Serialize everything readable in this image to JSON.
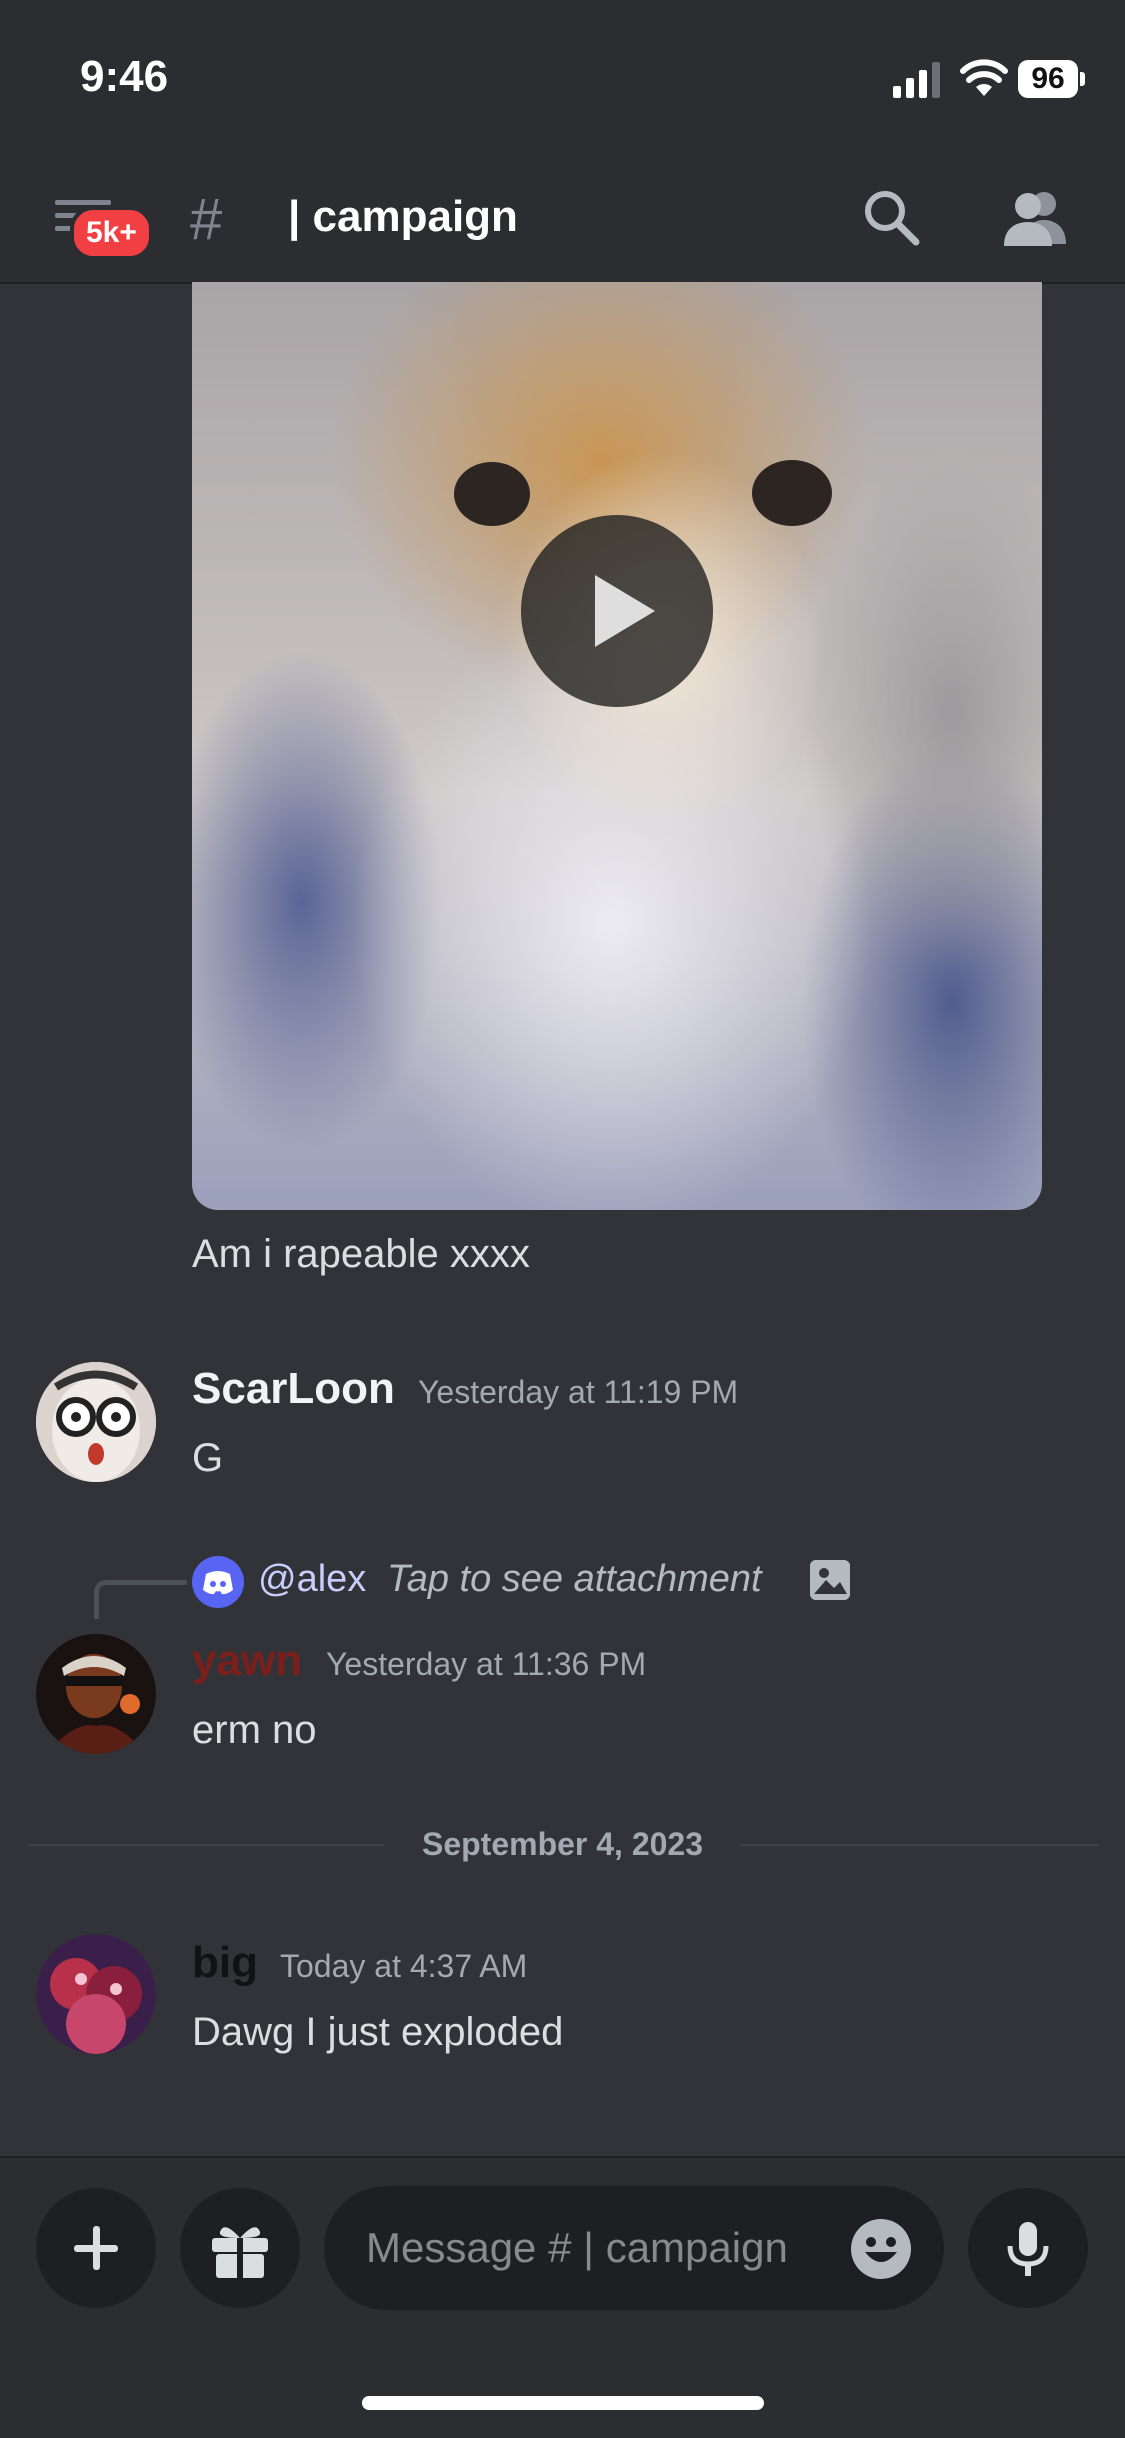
{
  "status_bar": {
    "time": "9:46",
    "battery": "96"
  },
  "header": {
    "badge": "5k+",
    "channel_name": "| campaign"
  },
  "messages": [
    {
      "text": "Am i rapeable xxxx"
    },
    {
      "username": "ScarLoon",
      "timestamp": "Yesterday at 11:19 PM",
      "text": "G"
    },
    {
      "reply_mention": "@alex",
      "reply_text": "Tap to see attachment",
      "username": "yawn",
      "timestamp": "Yesterday at 11:36 PM",
      "text": "erm no"
    },
    {
      "username": "big",
      "timestamp": "Today at 4:37 AM",
      "text": "Dawg I just exploded"
    }
  ],
  "date_divider": "September 4, 2023",
  "composer": {
    "placeholder": "Message # | campaign"
  },
  "colors": {
    "background": "#313338",
    "header": "#2b2d31",
    "badge": "#f23f43",
    "yawn_name": "#7a1f1c",
    "big_name": "#111214"
  }
}
